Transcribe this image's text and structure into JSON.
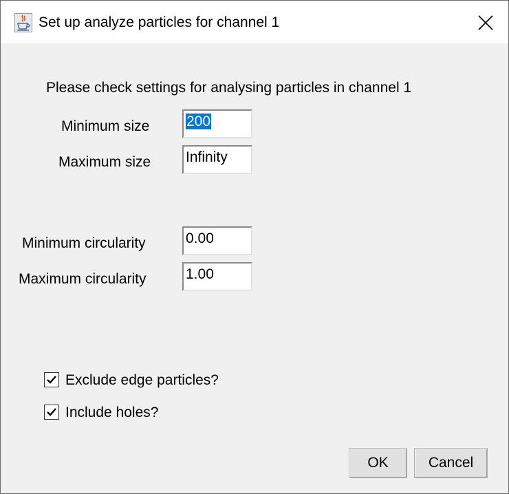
{
  "window": {
    "title": "Set up analyze particles for channel 1",
    "icon": "java-cup-icon",
    "close_icon": "close-icon"
  },
  "dialog": {
    "message": "Please check settings for analysing particles in channel 1",
    "fields": {
      "min_size": {
        "label": "Minimum size",
        "value": "200",
        "selected": true
      },
      "max_size": {
        "label": "Maximum size",
        "value": "Infinity"
      },
      "min_circularity": {
        "label": "Minimum circularity",
        "value": "0.00"
      },
      "max_circularity": {
        "label": "Maximum circularity",
        "value": "1.00"
      }
    },
    "checkboxes": {
      "exclude_edges": {
        "label": "Exclude edge particles?",
        "checked": true
      },
      "include_holes": {
        "label": "Include holes?",
        "checked": true
      }
    },
    "buttons": {
      "ok": "OK",
      "cancel": "Cancel"
    }
  },
  "colors": {
    "selection": "#0078d7",
    "background": "#f0f0f0"
  }
}
